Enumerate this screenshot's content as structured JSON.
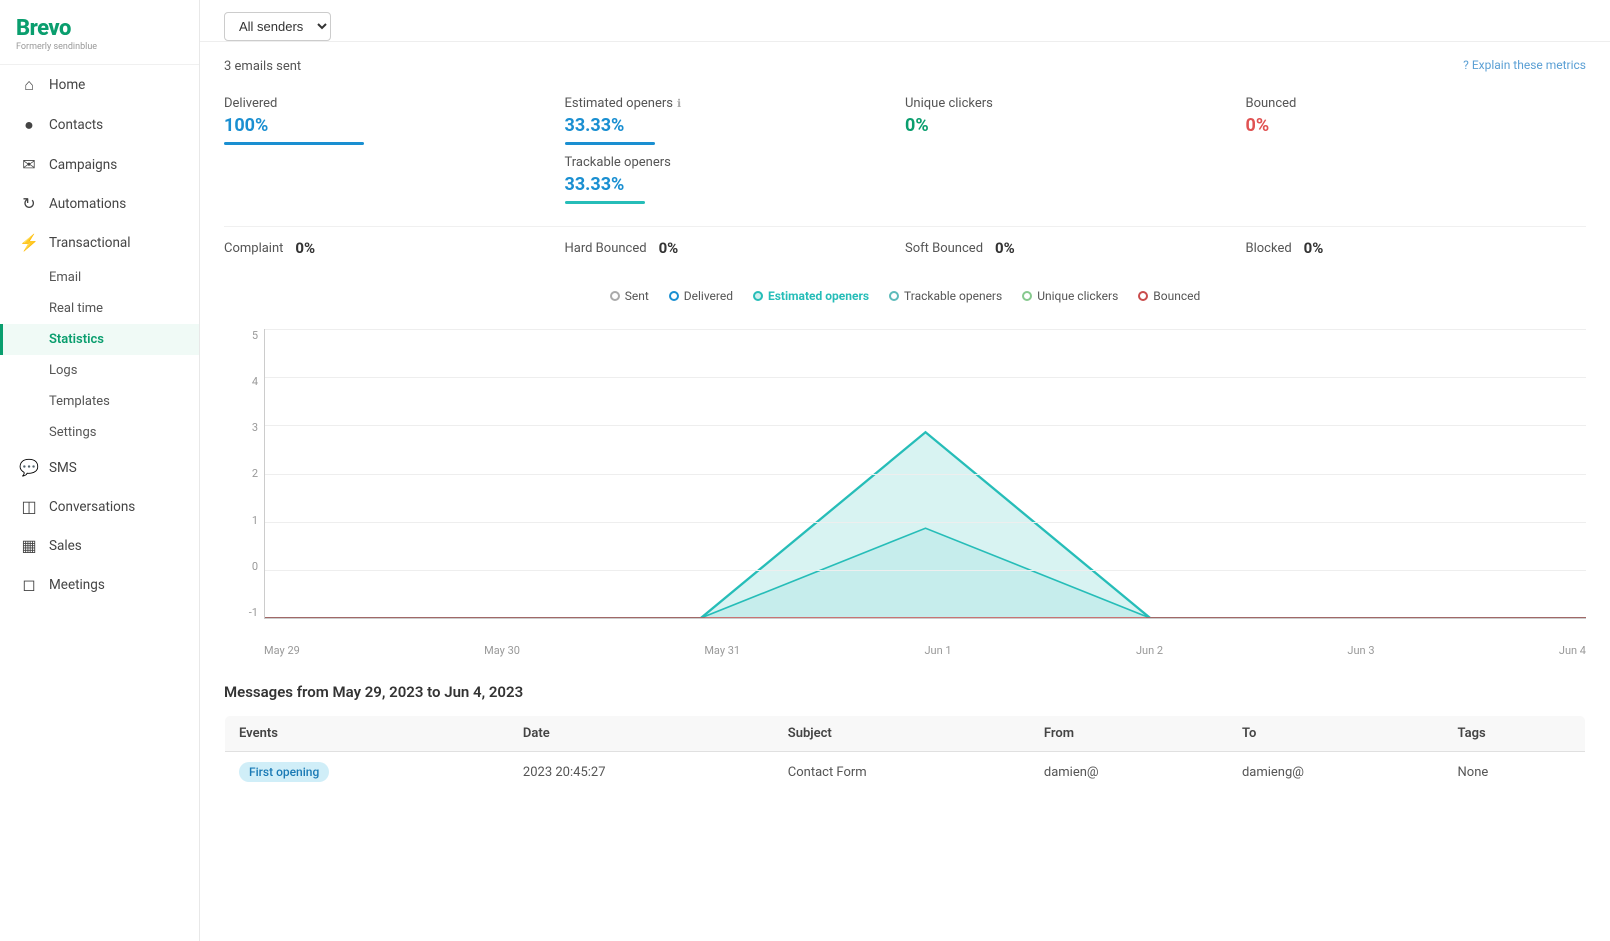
{
  "logo": {
    "name": "Brevo",
    "sub": "Formerly sendinblue"
  },
  "sidebar": {
    "items": [
      {
        "id": "home",
        "label": "Home",
        "icon": "⌂"
      },
      {
        "id": "contacts",
        "label": "Contacts",
        "icon": "👤"
      },
      {
        "id": "campaigns",
        "label": "Campaigns",
        "icon": "✉"
      },
      {
        "id": "automations",
        "label": "Automations",
        "icon": "↻"
      },
      {
        "id": "transactional",
        "label": "Transactional",
        "icon": "⚡"
      },
      {
        "id": "sms",
        "label": "SMS",
        "icon": "💬"
      },
      {
        "id": "conversations",
        "label": "Conversations",
        "icon": "📊"
      },
      {
        "id": "sales",
        "label": "Sales",
        "icon": "📈"
      },
      {
        "id": "meetings",
        "label": "Meetings",
        "icon": "📅"
      }
    ],
    "sub_items": [
      {
        "id": "email",
        "label": "Email"
      },
      {
        "id": "real-time",
        "label": "Real time"
      },
      {
        "id": "statistics",
        "label": "Statistics",
        "active": true
      },
      {
        "id": "logs",
        "label": "Logs"
      },
      {
        "id": "templates",
        "label": "Templates"
      },
      {
        "id": "settings",
        "label": "Settings"
      }
    ]
  },
  "header": {
    "filter_placeholder": "All senders",
    "emails_sent": "3 emails sent",
    "explain_link": "Explain these metrics"
  },
  "metrics": {
    "delivered": {
      "label": "Delivered",
      "value": "100%",
      "color": "blue"
    },
    "estimated_openers": {
      "label": "Estimated openers",
      "value": "33.33%",
      "color": "blue",
      "has_info": true
    },
    "trackable_openers": {
      "label": "Trackable openers",
      "value": "33.33%",
      "color": "blue"
    },
    "unique_clickers": {
      "label": "Unique clickers",
      "value": "0%",
      "color": "green"
    },
    "bounced": {
      "label": "Bounced",
      "value": "0%",
      "color": "red"
    }
  },
  "metrics_row2": {
    "complaint": {
      "label": "Complaint",
      "value": "0%"
    },
    "hard_bounced": {
      "label": "Hard Bounced",
      "value": "0%"
    },
    "soft_bounced": {
      "label": "Soft Bounced",
      "value": "0%"
    },
    "blocked": {
      "label": "Blocked",
      "value": "0%"
    }
  },
  "chart": {
    "legend": [
      {
        "id": "sent",
        "label": "Sent",
        "active": false
      },
      {
        "id": "delivered",
        "label": "Delivered",
        "active": false
      },
      {
        "id": "estimated",
        "label": "Estimated openers",
        "active": true
      },
      {
        "id": "trackable",
        "label": "Trackable openers",
        "active": false
      },
      {
        "id": "unique",
        "label": "Unique clickers",
        "active": false
      },
      {
        "id": "bounced",
        "label": "Bounced",
        "active": false
      }
    ],
    "y_labels": [
      "5",
      "4",
      "3",
      "2",
      "1",
      "0",
      "-1"
    ],
    "x_labels": [
      "May 29",
      "May 30",
      "May 31",
      "Jun 1",
      "Jun 2",
      "Jun 3",
      "Jun 4"
    ]
  },
  "messages_table": {
    "title": "Messages from May 29, 2023 to Jun 4, 2023",
    "columns": [
      "Events",
      "Date",
      "Subject",
      "From",
      "To",
      "Tags"
    ],
    "rows": [
      {
        "event": "First opening",
        "date": "2023 20:45:27",
        "subject": "Contact Form",
        "from": "damien@",
        "to": "damieng@",
        "tags": "None"
      }
    ]
  }
}
